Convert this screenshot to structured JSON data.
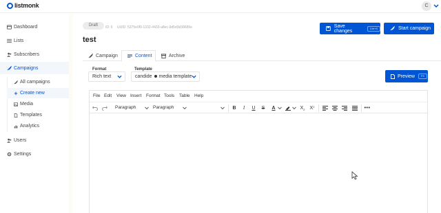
{
  "app": {
    "name": "listmonk",
    "user_initial": "C"
  },
  "sidebar": {
    "items": [
      {
        "label": "Dashboard",
        "icon": "dashboard-icon"
      },
      {
        "label": "Lists",
        "icon": "lists-icon"
      },
      {
        "label": "Subscribers",
        "icon": "subscribers-icon"
      },
      {
        "label": "Campaigns",
        "icon": "campaigns-icon",
        "active": true
      },
      {
        "label": "Users",
        "icon": "users-icon"
      },
      {
        "label": "Settings",
        "icon": "settings-icon"
      }
    ],
    "campaign_subitems": [
      {
        "label": "All campaigns",
        "icon": "rocket-icon"
      },
      {
        "label": "Create new",
        "icon": "plus-icon",
        "active": true
      },
      {
        "label": "Media",
        "icon": "image-icon"
      },
      {
        "label": "Templates",
        "icon": "file-icon"
      },
      {
        "label": "Analytics",
        "icon": "chart-icon"
      }
    ]
  },
  "campaign": {
    "status": "Draft",
    "id_label": "ID: 6",
    "uuid_label": "UUID: 5375e0f0-1332-4433-a8ec-9d5d3d38689e",
    "title": "test"
  },
  "actions": {
    "save_label": "Save changes",
    "save_shortcut": "Ctrl+S",
    "start_label": "Start campaign",
    "preview_label": "Preview",
    "preview_shortcut": "F9"
  },
  "tabs": [
    {
      "label": "Campaign",
      "icon": "rocket-icon"
    },
    {
      "label": "Content",
      "icon": "content-icon",
      "active": true
    },
    {
      "label": "Archive",
      "icon": "archive-icon"
    }
  ],
  "format": {
    "label": "Format",
    "value": "Rich text"
  },
  "template": {
    "label": "Template",
    "value_left": "candide",
    "value_right": "media template"
  },
  "editor": {
    "menu": [
      "File",
      "Edit",
      "View",
      "Insert",
      "Format",
      "Tools",
      "Table",
      "Help"
    ],
    "block_select": "Paragraph",
    "font_select": "Paragraph"
  },
  "colors": {
    "accent": "#0055d4"
  }
}
